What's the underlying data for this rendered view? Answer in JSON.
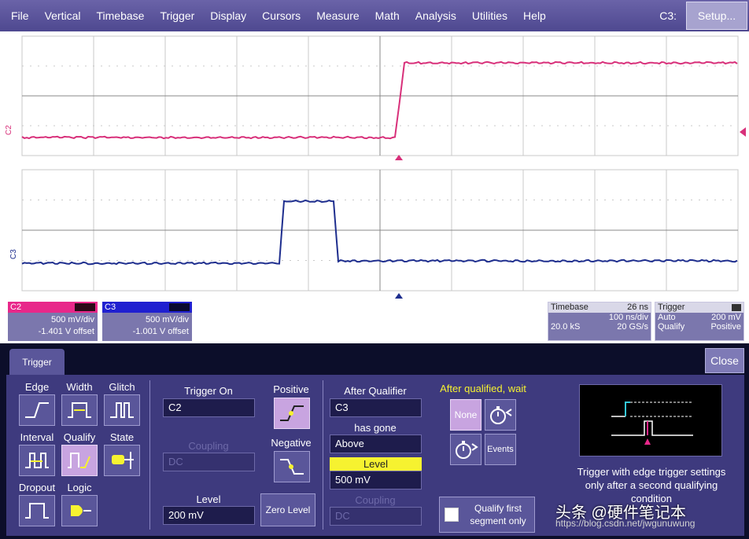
{
  "menubar": {
    "items": [
      "File",
      "Vertical",
      "Timebase",
      "Trigger",
      "Display",
      "Cursors",
      "Measure",
      "Math",
      "Analysis",
      "Utilities",
      "Help"
    ],
    "channel": "C3:",
    "setup": "Setup..."
  },
  "traces": {
    "top": {
      "label": "C2",
      "color": "#d8307a"
    },
    "bottom": {
      "label": "C3",
      "color": "#1e2e8e"
    }
  },
  "channels": [
    {
      "name": "C2",
      "scale": "500 mV/div",
      "offset": "-1.401 V offset",
      "color": "#e8288a"
    },
    {
      "name": "C3",
      "scale": "500 mV/div",
      "offset": "-1.001 V offset",
      "color": "#2020d0"
    }
  ],
  "timebase": {
    "title": "Timebase",
    "delay": "26 ns",
    "per_div": "100 ns/div",
    "samples": "20.0 kS",
    "rate": "20 GS/s"
  },
  "trigger_box": {
    "title": "Trigger",
    "mode": "Auto",
    "level": "200 mV",
    "type": "Qualify",
    "slope": "Positive"
  },
  "panel": {
    "tab": "Trigger",
    "close": "Close",
    "types": {
      "edge": "Edge",
      "width": "Width",
      "glitch": "Glitch",
      "interval": "Interval",
      "qualify": "Qualify",
      "state": "State",
      "dropout": "Dropout",
      "logic": "Logic"
    },
    "trigger_on": {
      "label": "Trigger On",
      "value": "C2"
    },
    "coupling": {
      "label": "Coupling",
      "value": "DC"
    },
    "level": {
      "label": "Level",
      "value": "200 mV"
    },
    "zero_level": "Zero Level",
    "positive": "Positive",
    "negative": "Negative",
    "after_qualifier": {
      "label": "After Qualifier",
      "value": "C3"
    },
    "has_gone": {
      "label": "has gone",
      "value": "Above"
    },
    "qual_level": {
      "label": "Level",
      "value": "500 mV"
    },
    "qual_coupling": {
      "label": "Coupling",
      "value": "DC"
    },
    "after_wait": "After qualified, wait",
    "none": "None",
    "events": "Events",
    "qualify_first": "Qualify first segment only",
    "description": "Trigger with edge trigger settings only after a second qualifying condition"
  },
  "watermark": {
    "text": "头条 @硬件笔记本",
    "url": "https://blog.csdn.net/jwgunuwung"
  }
}
